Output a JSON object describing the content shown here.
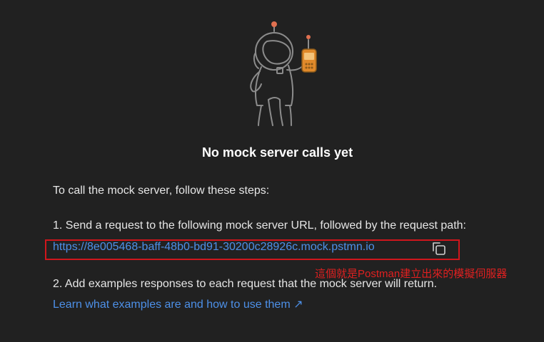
{
  "empty_state": {
    "illustration": "astronaut-with-walkie-talkie",
    "title": "No mock server calls yet",
    "intro": "To call the mock server, follow these steps:",
    "step1": "1. Send a request to the following mock server URL, followed by the request path:",
    "mock_url": "https://8e005468-baff-48b0-bd91-30200c28926c.mock.pstmn.io",
    "copy_icon": "copy-icon",
    "step2": "2. Add examples responses to each request that the mock server will return.",
    "learn_link": "Learn what examples are and how to use them ↗"
  },
  "annotation": {
    "text": "這個就是Postman建立出來的模擬伺服器",
    "color": "#e02020"
  },
  "colors": {
    "background": "#212121",
    "link": "#4d90e8",
    "annotation_box": "#d0161c"
  }
}
